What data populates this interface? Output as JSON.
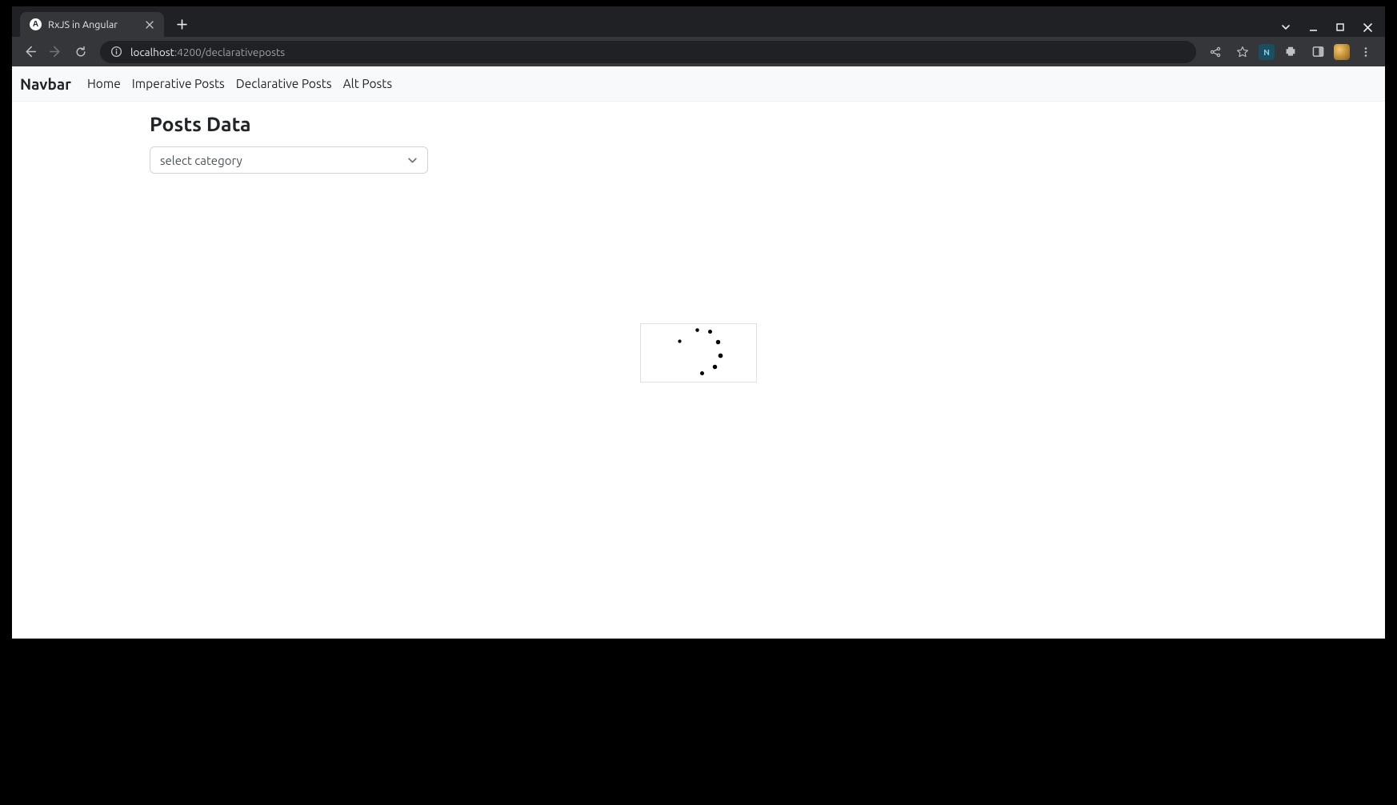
{
  "browser": {
    "tab_title": "RxJS in Angular",
    "favicon_letter": "A",
    "url_host": "localhost",
    "url_port_path": ":4200/declarativeposts"
  },
  "nav": {
    "brand": "Navbar",
    "links": [
      "Home",
      "Imperative Posts",
      "Declarative Posts",
      "Alt Posts"
    ]
  },
  "page": {
    "heading": "Posts Data",
    "select_placeholder": "select category"
  },
  "extensions": {
    "badge_a_label": "N"
  }
}
